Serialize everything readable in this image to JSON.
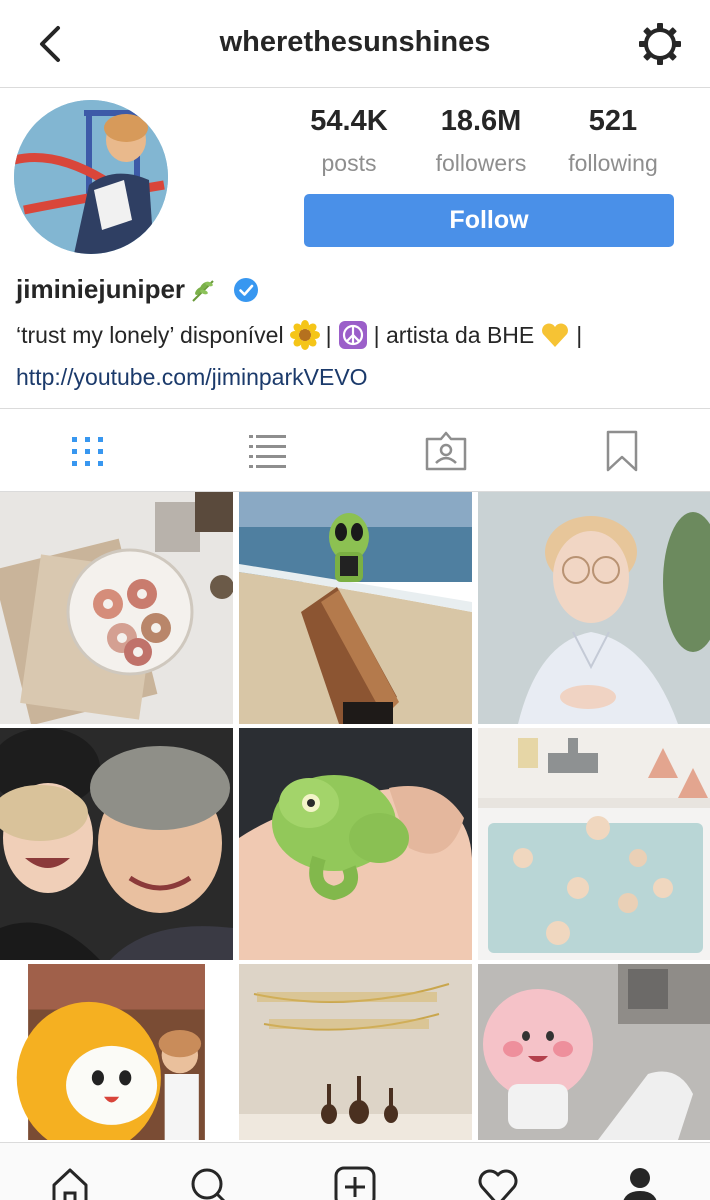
{
  "header": {
    "title": "wherethesunshines",
    "back_icon": "chevron-left-icon",
    "settings_icon": "gear-icon"
  },
  "profile": {
    "stats": [
      {
        "value": "54.4K",
        "label": "posts"
      },
      {
        "value": "18.6M",
        "label": "followers"
      },
      {
        "value": "521",
        "label": "following"
      }
    ],
    "follow_label": "Follow",
    "username": "jiminiejuniper",
    "verified": true,
    "bio_parts": [
      "‘trust my lonely’ disponível",
      "|",
      "| artista da BHE",
      "|"
    ],
    "link": "http://youtube.com/jiminparkVEVO"
  },
  "tabs": [
    {
      "icon": "grid-view-icon",
      "active": true
    },
    {
      "icon": "list-view-icon",
      "active": false
    },
    {
      "icon": "tagged-photos-icon",
      "active": false
    },
    {
      "icon": "saved-bookmark-icon",
      "active": false
    }
  ],
  "posts": [
    {
      "subject": "donuts and newspaper"
    },
    {
      "subject": "alien on ukulele at beach"
    },
    {
      "subject": "portrait with round glasses"
    },
    {
      "subject": "two friends selfie"
    },
    {
      "subject": "chameleon in hand"
    },
    {
      "subject": "bathtub with roses"
    },
    {
      "subject": "plush toy with person"
    },
    {
      "subject": "ukuleles with banner"
    },
    {
      "subject": "pink peach plush"
    }
  ],
  "bottom_nav": [
    {
      "icon": "home-icon"
    },
    {
      "icon": "search-icon"
    },
    {
      "icon": "add-post-icon"
    },
    {
      "icon": "activity-heart-icon"
    },
    {
      "icon": "profile-icon"
    }
  ],
  "colors": {
    "accent": "#4a90e8",
    "verified": "#3897f0",
    "text": "#262626",
    "muted": "#8e8e8e",
    "link": "#1b3a6b"
  }
}
